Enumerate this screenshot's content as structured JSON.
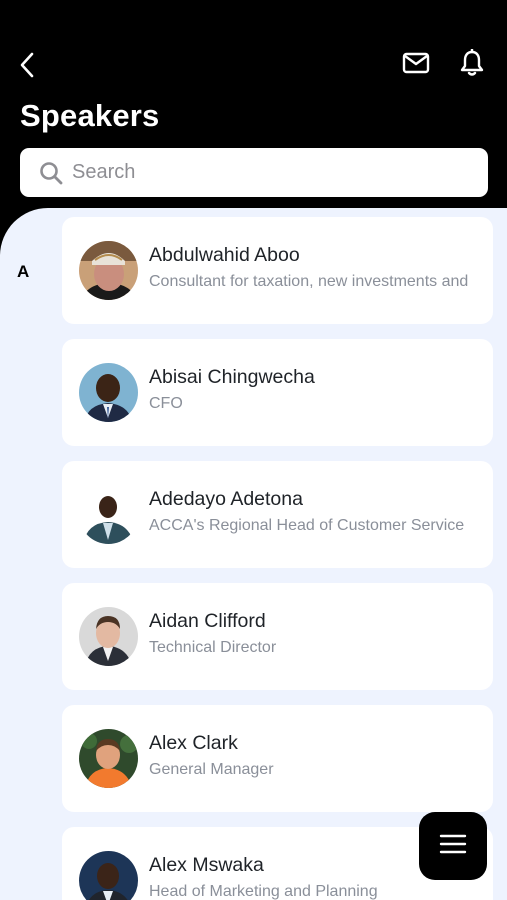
{
  "header": {
    "title": "Speakers",
    "icons": [
      "back-icon",
      "mail-icon",
      "bell-icon"
    ]
  },
  "search": {
    "placeholder": "Search",
    "value": ""
  },
  "list": {
    "section": "A",
    "speakers": [
      {
        "name": "Abdulwahid Aboo",
        "role": "Consultant for taxation, new investments and"
      },
      {
        "name": "Abisai Chingwecha",
        "role": "CFO"
      },
      {
        "name": "Adedayo Adetona",
        "role": "ACCA's Regional Head of Customer Service"
      },
      {
        "name": "Aidan Clifford",
        "role": "Technical Director"
      },
      {
        "name": "Alex Clark",
        "role": "General Manager"
      },
      {
        "name": "Alex Mswaka",
        "role": "Head of Marketing and Planning"
      }
    ]
  },
  "fab": {
    "icon": "menu-icon"
  },
  "colors": {
    "header_bg": "#000000",
    "content_bg": "#eef3fe",
    "card_bg": "#ffffff",
    "name_text": "#1f2328",
    "role_text": "#8a8f99"
  }
}
